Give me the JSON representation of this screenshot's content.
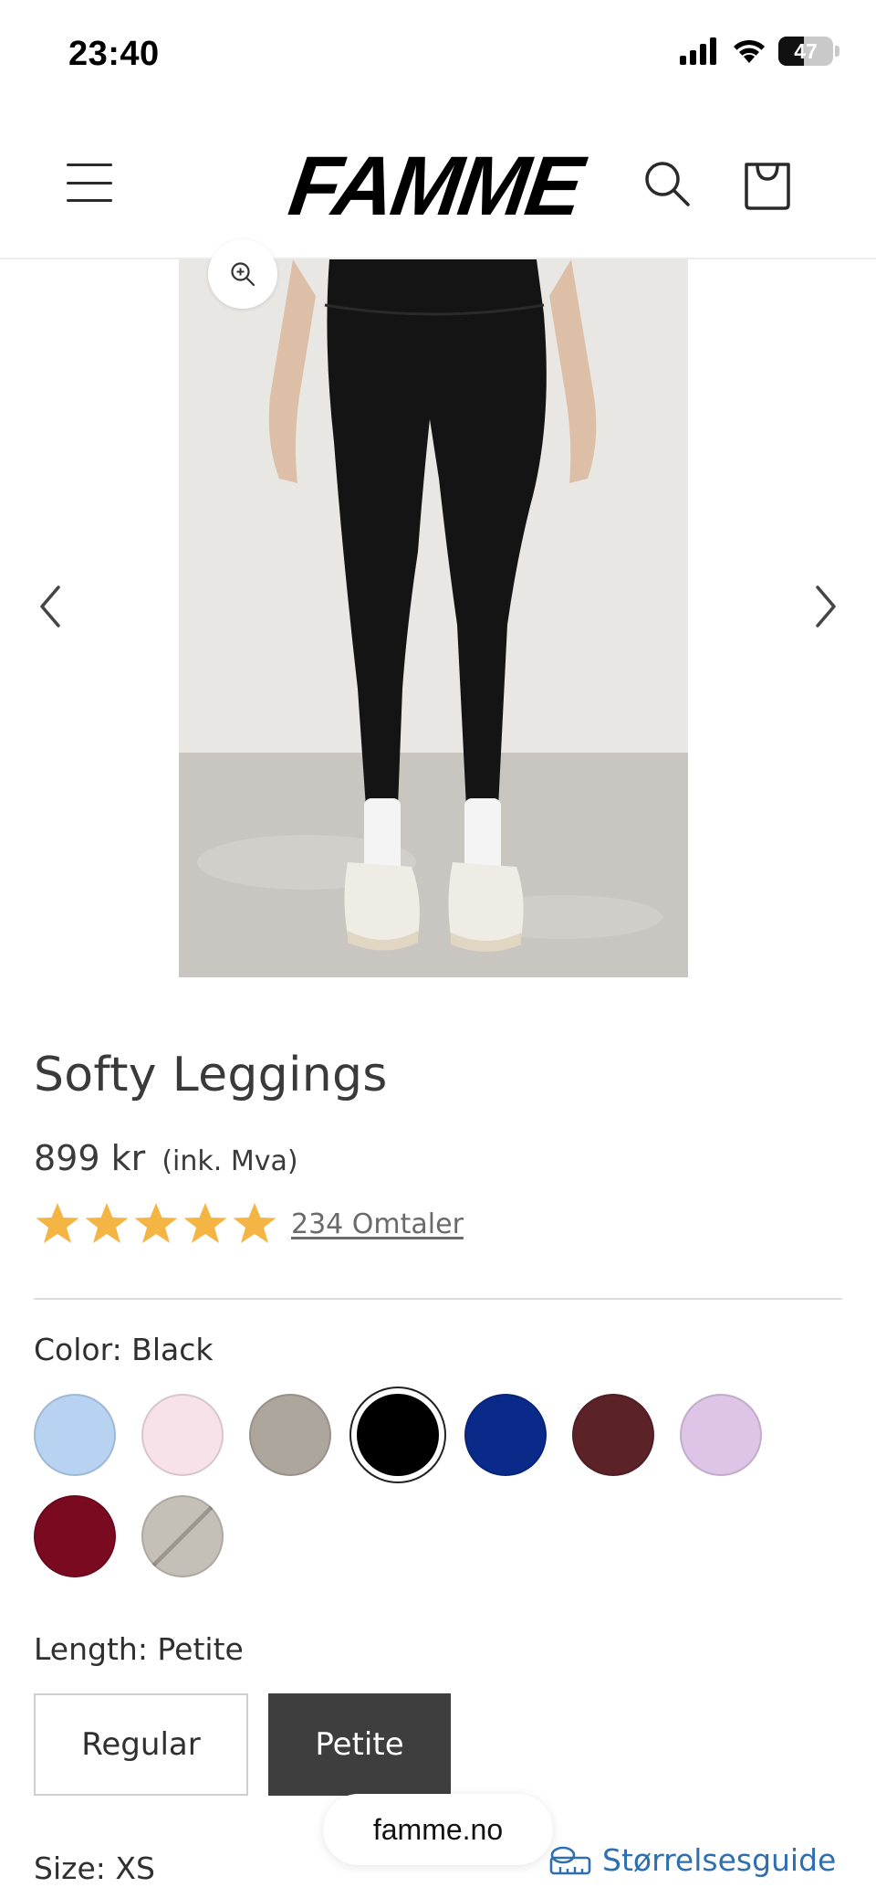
{
  "status_bar": {
    "time": "23:40",
    "battery": "47",
    "battery_level": 0.47,
    "icons": [
      "cellular-signal-icon",
      "wifi-icon",
      "battery-icon"
    ]
  },
  "header": {
    "logo": "FAMME",
    "icons": [
      "menu-icon",
      "search-icon",
      "cart-icon"
    ]
  },
  "gallery": {
    "icons": [
      "zoom-icon",
      "chevron-left-icon",
      "chevron-right-icon"
    ]
  },
  "product": {
    "title": "Softy Leggings",
    "price": "899 kr",
    "price_note": "(ink. Mva)",
    "rating_stars": 5,
    "rating_max": 5,
    "star_color": "#F5B544",
    "reviews_link": "234 Omtaler"
  },
  "color_option": {
    "label": "Color: Black",
    "swatches": [
      {
        "color": "#B8D2F2"
      },
      {
        "color": "#F7E2EA"
      },
      {
        "color": "#ADA69D"
      },
      {
        "color": "#000000",
        "selected": true
      },
      {
        "color": "#0A2A8A"
      },
      {
        "color": "#5B2228"
      },
      {
        "color": "#DEC4E6"
      },
      {
        "color": "#7A0A20"
      },
      {
        "color": "#C5C0B7",
        "style": "sold-out"
      }
    ]
  },
  "length_option": {
    "label": "Length: Petite",
    "options": [
      "Regular",
      "Petite"
    ],
    "selected": "Petite"
  },
  "size_option": {
    "label": "Size: XS",
    "size_guide": "Størrelsesguide",
    "size_guide_color": "#2E6FB0"
  },
  "browser": {
    "url": "famme.no"
  }
}
